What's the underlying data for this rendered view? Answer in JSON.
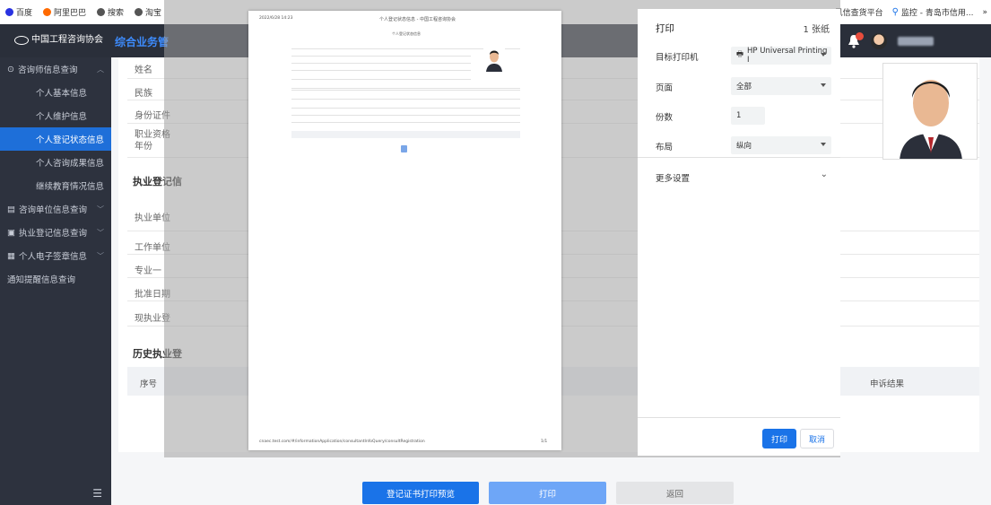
{
  "bookmarks": {
    "items": [
      {
        "label": "百度",
        "icon": "paw-icon",
        "color": "#2932e1"
      },
      {
        "label": "阿里巴巴",
        "icon": "alibaba-icon",
        "color": "#ff6a00"
      },
      {
        "label": "搜索",
        "icon": "globe-icon",
        "color": "#555555"
      },
      {
        "label": "淘宝",
        "icon": "globe-icon",
        "color": "#555555"
      }
    ],
    "right_items": [
      {
        "label": "风信查货平台",
        "icon": ""
      },
      {
        "label": "监控 - 青岛市信用...",
        "icon": "pin-icon"
      }
    ],
    "overflow": "»"
  },
  "header": {
    "logo_text": "中国工程咨询协会",
    "app_title": "综合业务管",
    "notification_count": "1"
  },
  "sidebar": {
    "items": [
      {
        "label": "咨询师信息查询",
        "type": "group",
        "expanded": true
      },
      {
        "label": "个人基本信息",
        "type": "sub"
      },
      {
        "label": "个人维护信息",
        "type": "sub"
      },
      {
        "label": "个人登记状态信息",
        "type": "sub",
        "active": true
      },
      {
        "label": "个人咨询成果信息",
        "type": "sub"
      },
      {
        "label": "继续教育情况信息",
        "type": "sub"
      },
      {
        "label": "咨询单位信息查询",
        "type": "group"
      },
      {
        "label": "执业登记信息查询",
        "type": "group"
      },
      {
        "label": "个人电子签章信息",
        "type": "group"
      },
      {
        "label": "通知提醒信息查询",
        "type": "plain"
      }
    ]
  },
  "main": {
    "rows_top": [
      "姓名",
      "民族",
      "身份证件",
      "职业资格\n年份"
    ],
    "section_reg": "执业登记信",
    "rows_reg": [
      "执业单位",
      "工作单位",
      "专业一",
      "批准日期",
      "现执业登"
    ],
    "section_history": "历史执业登",
    "table_head": {
      "seq": "序号",
      "result": "申诉结果"
    }
  },
  "buttons": {
    "preview": "登记证书打印预览",
    "print": "打印",
    "back": "返回"
  },
  "print_preview": {
    "timestamp": "2022/6/28 14:23",
    "doc_title": "个人登记状态信息 - 中国工程咨询协会",
    "heading": "个人登记状态信息",
    "footer_url": "cnaec.test.com/#/informationApplication/consultantInfoQuery/consultRegistration",
    "page_num": "1/1"
  },
  "print_dialog": {
    "title": "打印",
    "sheet_count": "1 张纸",
    "printer_label": "目标打印机",
    "printer_value": "HP Universal Printing I",
    "pages_label": "页面",
    "pages_value": "全部",
    "copies_label": "份数",
    "copies_value": "1",
    "layout_label": "布局",
    "layout_value": "纵向",
    "more_settings": "更多设置",
    "print_button": "打印",
    "cancel_button": "取消"
  }
}
